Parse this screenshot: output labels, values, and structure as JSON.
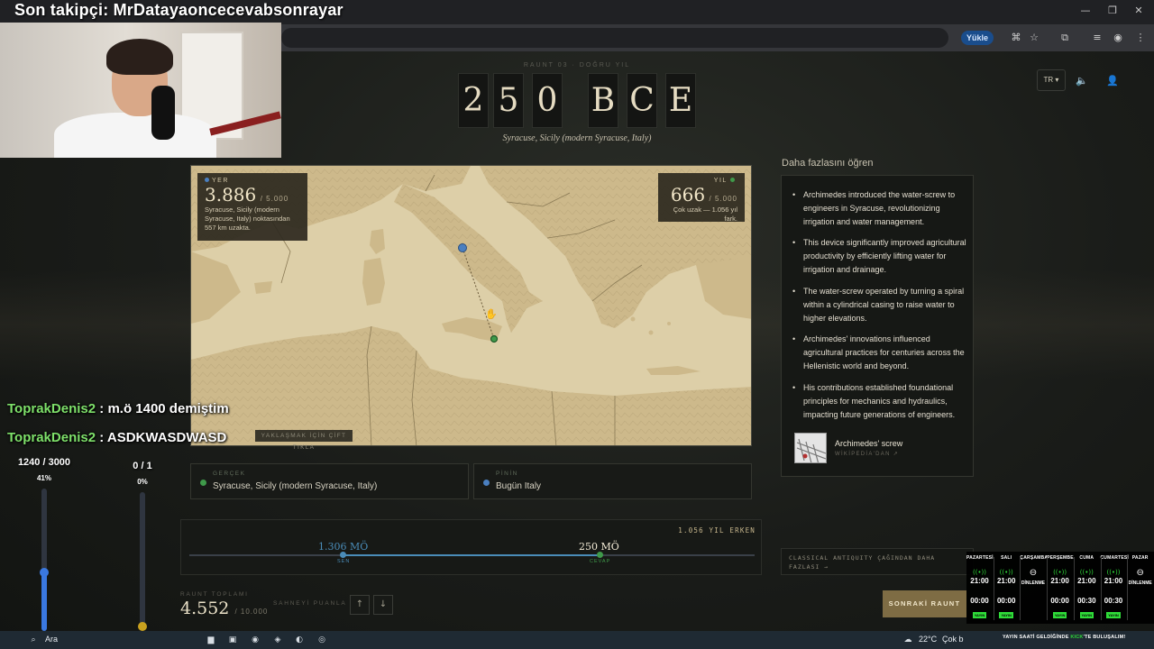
{
  "stream": {
    "follower_text": "Son takipçi: MrDatayaoncecevabsonrayar",
    "chat": [
      {
        "user": "ToprakDenis2",
        "sep": ":",
        "message": "m.ö 1400 demiştim"
      },
      {
        "user": "ToprakDenis2",
        "sep": ":",
        "message": "ASDKWASDWASD"
      }
    ],
    "meters": [
      {
        "label": "1240 / 3000",
        "pct_label": "41%",
        "fraction": 0.41,
        "color": "#3a78e0"
      },
      {
        "label": "0 / 1",
        "pct_label": "0%",
        "fraction": 0.0,
        "color": "#c9a11f"
      }
    ]
  },
  "browser": {
    "translate_button": "Yükle",
    "controls": {
      "minimize": "—",
      "restore": "❐",
      "close": "✕"
    }
  },
  "header": {
    "round_label": "RAUNT 03 · DOĞRU YIL",
    "year_chars": [
      "2",
      "5",
      "0",
      "B",
      "C",
      "E"
    ],
    "place": "Syracuse, Sicily (modern Syracuse, Italy)",
    "lang": "TR ▾",
    "sound_icon": "🔈",
    "profile_icon": "👤"
  },
  "map": {
    "place_card": {
      "label": "YER",
      "score": "3.886",
      "max": "/ 5.000",
      "desc": "Syracuse, Sicily (modern Syracuse, Italy) noktasından 557 km uzakta.",
      "dot_color": "#4a7fc0"
    },
    "year_card": {
      "label": "YIL",
      "score": "666",
      "max": "/ 5.000",
      "desc": "Çok uzak — 1.056 yıl fark.",
      "dot_color": "#3f9a4a"
    },
    "hint": "YAKLAŞMAK İÇİN ÇİFT TIKLA",
    "colors": {
      "sea": "#ddcfa8",
      "land": "#cbb88a",
      "border": "#8a7a55"
    }
  },
  "answers": {
    "actual_label": "GERÇEK",
    "actual_value": "Syracuse, Sicily (modern Syracuse, Italy)",
    "guess_label": "PİNİN",
    "guess_value": "Bugün Italy"
  },
  "timeline": {
    "title": "1.056 YIL ERKEN",
    "guess_value": "1.306 MÖ",
    "guess_tag": "SEN",
    "answer_value": "250 MÖ",
    "answer_tag": "CEVAP"
  },
  "learn": {
    "title": "Daha fazlasını öğren",
    "facts": [
      "Archimedes introduced the water-screw to engineers in Syracuse, revolutionizing irrigation and water management.",
      "This device significantly improved agricultural productivity by efficiently lifting water for irrigation and drainage.",
      "The water-screw operated by turning a spiral within a cylindrical casing to raise water to higher elevations.",
      "Archimedes' innovations influenced agricultural practices for centuries across the Hellenistic world and beyond.",
      "His contributions established foundational principles for mechanics and hydraulics, impacting future generations of engineers."
    ],
    "wiki_name": "Archimedes' screw",
    "wiki_source": "WİKİPEDİA'DAN ↗"
  },
  "footer": {
    "round_total_label": "RAUNT TOPLAMI",
    "round_total": "4.552",
    "round_total_max": "/ 10.000",
    "rate_label": "SAHNEYİ PUANLA",
    "up": "↑",
    "down": "↓",
    "next": "SONRAKİ RAUNT",
    "more_link": "CLASSICAL ANTIQUITY ÇAĞINDAN DAHA FAZLASI →"
  },
  "schedule": {
    "days": [
      {
        "day": "PAZARTESİ",
        "rest": false,
        "t1": "21:00",
        "t2": "00:00",
        "badge": "YAYIN"
      },
      {
        "day": "SALI",
        "rest": false,
        "t1": "21:00",
        "t2": "00:00",
        "badge": "YAYIN"
      },
      {
        "day": "ÇARŞAMBA",
        "rest": true,
        "rest_label": "DİNLENME"
      },
      {
        "day": "PERŞEMBE",
        "rest": false,
        "t1": "21:00",
        "t2": "00:00",
        "badge": "YAYIN"
      },
      {
        "day": "CUMA",
        "rest": false,
        "t1": "21:00",
        "t2": "00:30",
        "badge": "YAYIN"
      },
      {
        "day": "CUMARTESİ",
        "rest": false,
        "t1": "21:00",
        "t2": "00:30",
        "badge": "YAYIN"
      },
      {
        "day": "PAZAR",
        "rest": true,
        "rest_label": "DİNLENME"
      }
    ],
    "signal_icon": "((•))",
    "rest_icon": "⊖"
  },
  "taskbar": {
    "search_text": "Ara",
    "weather": "22°C",
    "weather_desc": "Çok b",
    "banner_pre": "YAYIN SAATİ GELDİĞİNDE ",
    "banner_brand": "KICK",
    "banner_post": "'TE BULUŞALIM!"
  }
}
